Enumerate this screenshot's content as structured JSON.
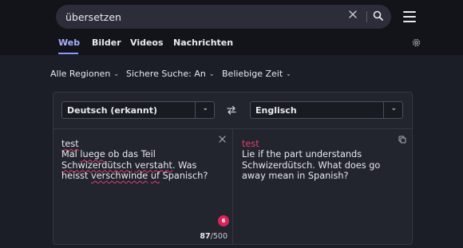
{
  "search": {
    "query": "übersetzen"
  },
  "tabs": [
    {
      "label": "Web",
      "active": true
    },
    {
      "label": "Bilder",
      "active": false
    },
    {
      "label": "Videos",
      "active": false
    },
    {
      "label": "Nachrichten",
      "active": false
    }
  ],
  "filters": {
    "region": "Alle Regionen",
    "safe_search": "Sichere Suche:  An",
    "time": "Beliebige Zeit"
  },
  "translator": {
    "source_lang": "Deutsch (erkannt)",
    "target_lang": "Englisch",
    "source_lines": [
      "test",
      "Mal luege ob das Teil",
      "Schwizerdütsch verstaht. Was",
      "heisst verschwinde uf Spanisch?"
    ],
    "source_flagged_words": [
      "test",
      "luege",
      "Schwizerdütsch",
      "verstaht",
      "verschwinde",
      "uf"
    ],
    "target_title": "test",
    "target_lines": [
      "Lie if the part understands",
      "Schwizerdütsch. What does go",
      "away mean in Spanish?"
    ],
    "error_count": "6",
    "char_count": "87",
    "char_limit": "/500"
  },
  "icons": {
    "clear": "close-icon",
    "search": "search-icon",
    "menu": "hamburger-menu-icon",
    "settings": "gear-icon",
    "swap": "swap-arrows-icon",
    "copy": "copy-icon"
  },
  "colors": {
    "accent": "#8f98ff",
    "header_bg": "#13141a",
    "page_bg": "#1c1e27",
    "panel_bg": "#22242e",
    "target_title": "#e0406a",
    "error_badge": "#d8235a"
  }
}
